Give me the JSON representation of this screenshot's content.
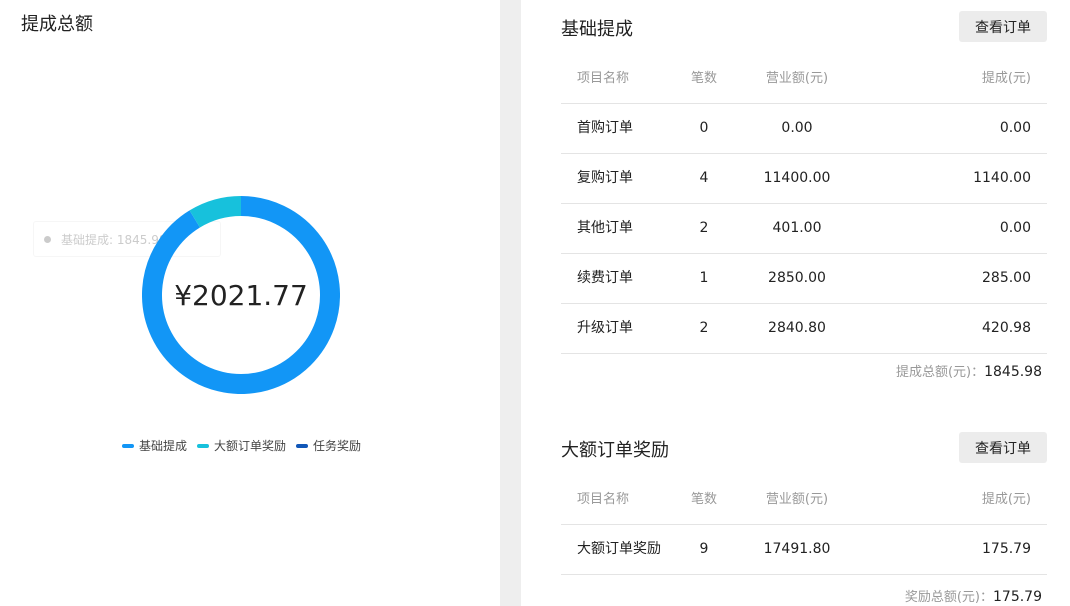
{
  "left": {
    "title": "提成总额",
    "amount": "¥2021.77",
    "tooltip": "基础提成: 1845.98",
    "legend": [
      {
        "label": "基础提成",
        "color": "#1296f6"
      },
      {
        "label": "大额订单奖励",
        "color": "#17c1dc"
      },
      {
        "label": "任务奖励",
        "color": "#1157b8"
      }
    ],
    "chart_data": {
      "type": "pie",
      "categories": [
        "基础提成",
        "大额订单奖励",
        "任务奖励"
      ],
      "values": [
        1845.98,
        175.79,
        0
      ],
      "colors": [
        "#1296f6",
        "#17c1dc",
        "#1157b8"
      ]
    }
  },
  "basic": {
    "title": "基础提成",
    "button": "查看订单",
    "headers": [
      "项目名称",
      "笔数",
      "营业额(元)",
      "提成(元)"
    ],
    "rows": [
      [
        "首购订单",
        "0",
        "0.00",
        "0.00"
      ],
      [
        "复购订单",
        "4",
        "11400.00",
        "1140.00"
      ],
      [
        "其他订单",
        "2",
        "401.00",
        "0.00"
      ],
      [
        "续费订单",
        "1",
        "2850.00",
        "285.00"
      ],
      [
        "升级订单",
        "2",
        "2840.80",
        "420.98"
      ]
    ],
    "total_label": "提成总额(元)：",
    "total_value": "1845.98"
  },
  "large": {
    "title": "大额订单奖励",
    "button": "查看订单",
    "headers": [
      "项目名称",
      "笔数",
      "营业额(元)",
      "提成(元)"
    ],
    "rows": [
      [
        "大额订单奖励",
        "9",
        "17491.80",
        "175.79"
      ]
    ],
    "total_label": "奖励总额(元)：",
    "total_value": "175.79"
  }
}
